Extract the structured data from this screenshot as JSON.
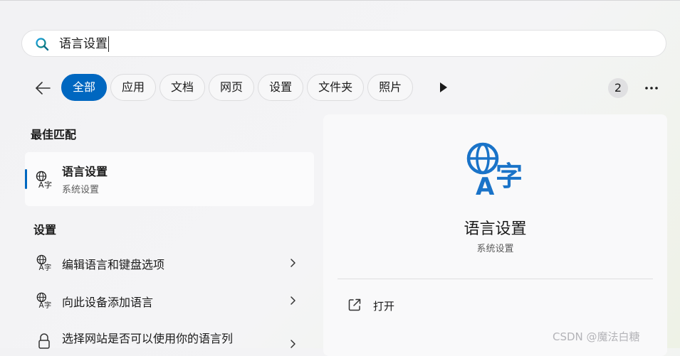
{
  "search": {
    "query": "语言设置"
  },
  "filters": [
    "全部",
    "应用",
    "文档",
    "网页",
    "设置",
    "文件夹",
    "照片"
  ],
  "badge_count": "2",
  "sections": {
    "best_match": "最佳匹配",
    "settings": "设置"
  },
  "best_match": {
    "title": "语言设置",
    "subtitle": "系统设置"
  },
  "settings_items": [
    {
      "label": "编辑语言和键盘选项"
    },
    {
      "label": "向此设备添加语言"
    },
    {
      "label": "选择网站是否可以使用你的语言列"
    }
  ],
  "detail": {
    "title": "语言设置",
    "subtitle": "系统设置",
    "open_label": "打开"
  },
  "watermark": "CSDN @魔法白糖",
  "colors": {
    "accent": "#0067c0",
    "icon_blue": "#1a73c8"
  }
}
